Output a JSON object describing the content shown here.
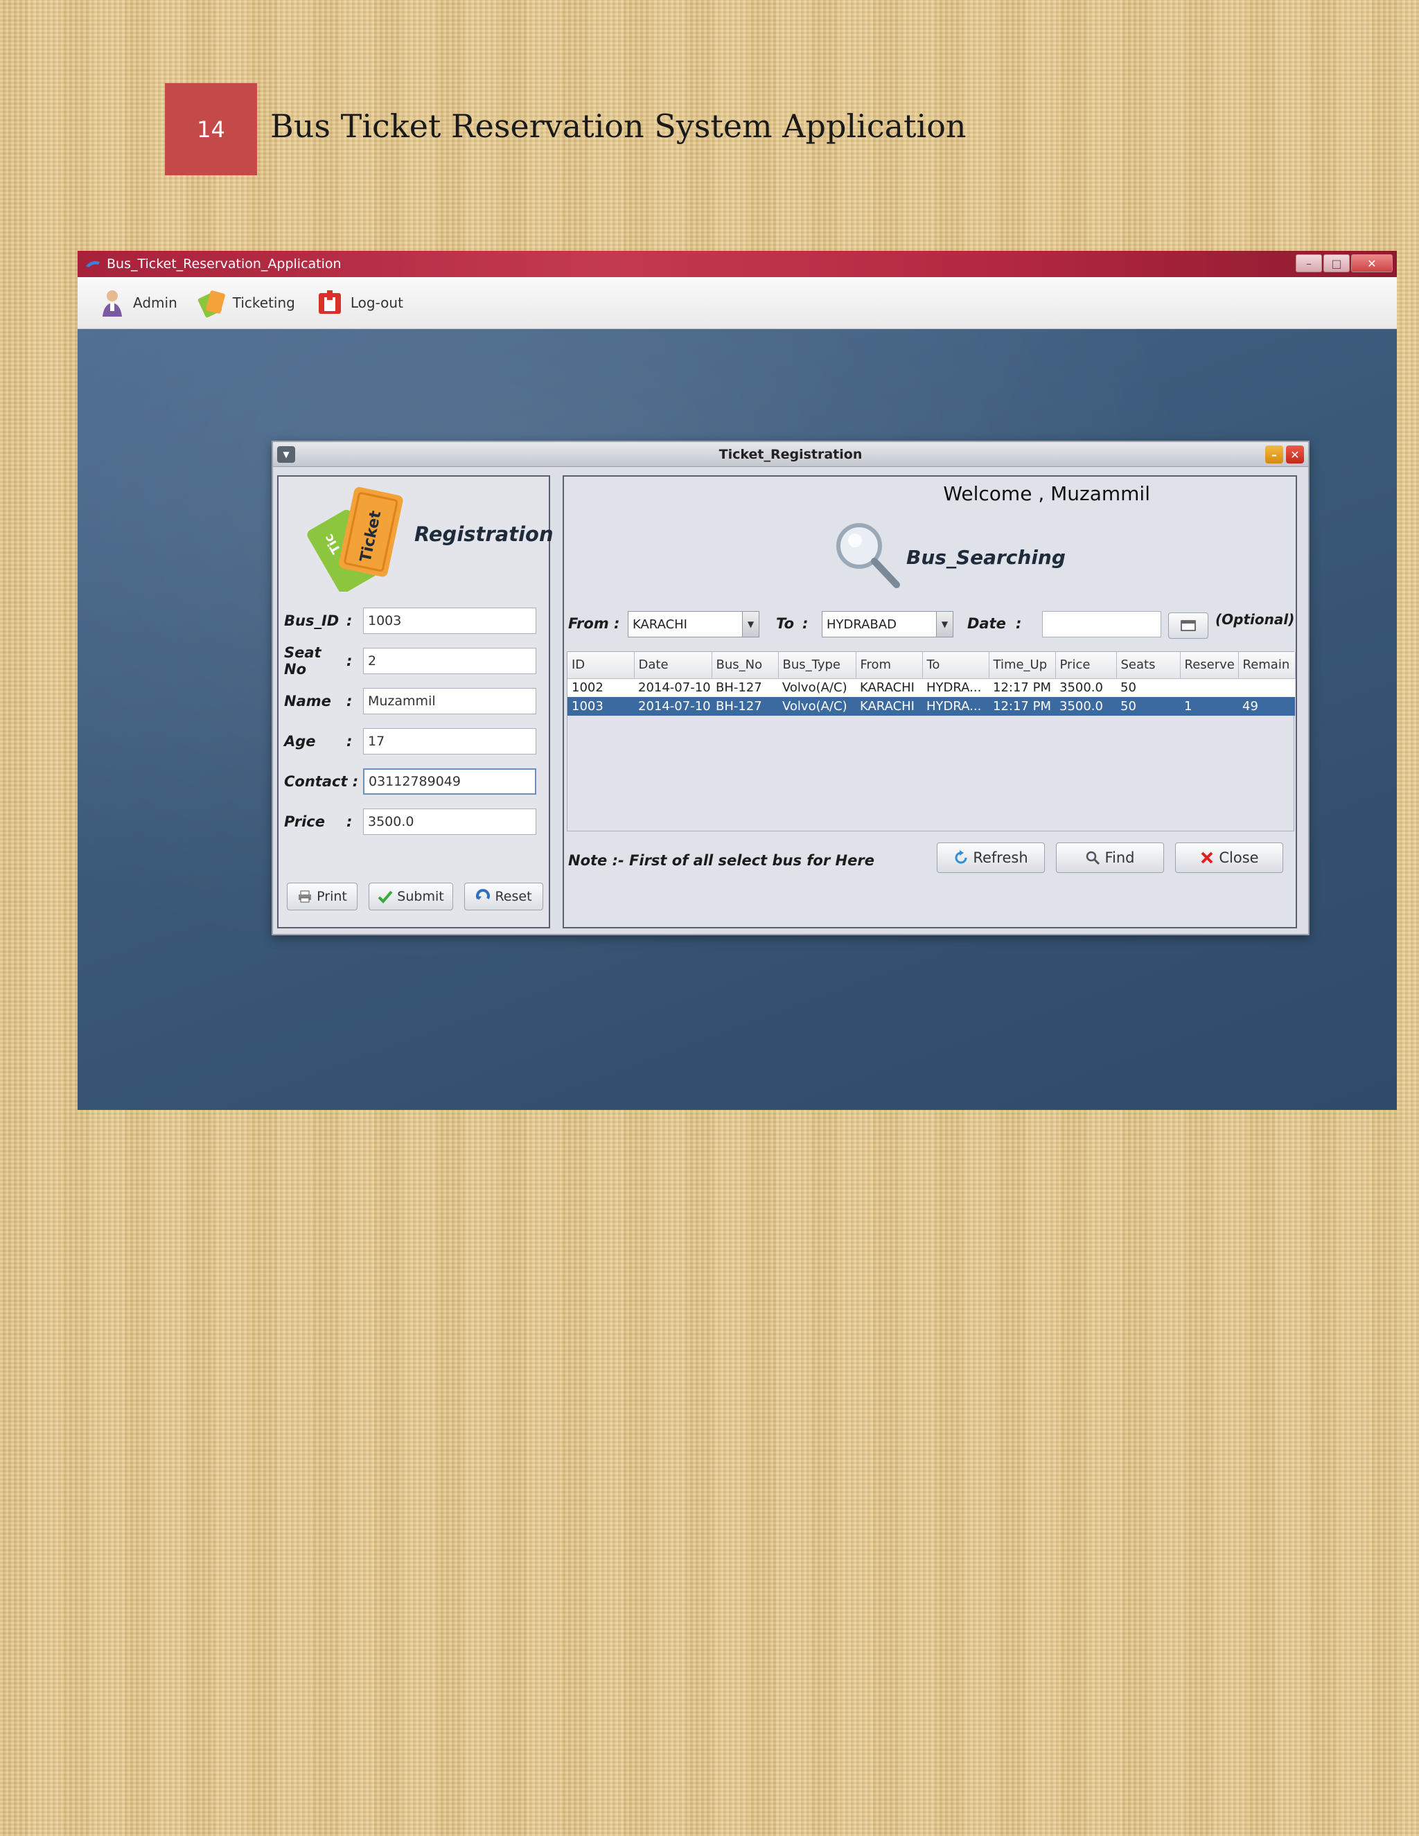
{
  "document": {
    "page_number": "14",
    "title": "Bus Ticket Reservation System Application"
  },
  "app": {
    "window_title": "Bus_Ticket_Reservation_Application",
    "menu": [
      {
        "label": "Admin",
        "icon": "admin-user-icon"
      },
      {
        "label": "Ticketing",
        "icon": "ticket-icon"
      },
      {
        "label": "Log-out",
        "icon": "logout-icon"
      }
    ]
  },
  "frame": {
    "title": "Ticket_Registration",
    "registration": {
      "heading": "Registration",
      "logo_text": [
        "Tic",
        "Ticket"
      ],
      "fields": [
        {
          "label": "Bus_ID",
          "value": "1003"
        },
        {
          "label": "Seat No",
          "value": "2"
        },
        {
          "label": "Name",
          "value": "Muzammil"
        },
        {
          "label": "Age",
          "value": "17"
        },
        {
          "label": "Contact :",
          "value": "03112789049"
        },
        {
          "label": "Price",
          "value": "3500.0"
        }
      ],
      "buttons": {
        "print": "Print",
        "submit": "Submit",
        "reset": "Reset"
      }
    },
    "search": {
      "welcome": "Welcome , Muzammil",
      "heading": "Bus_Searching",
      "from_label": "From :",
      "from_value": "KARACHI",
      "to_label": "To",
      "to_value": "HYDRABAD",
      "date_label": "Date",
      "optional_label": "(Optional)",
      "table": {
        "columns": [
          "ID",
          "Date",
          "Bus_No",
          "Bus_Type",
          "From",
          "To",
          "Time_Up",
          "Price",
          "Seats",
          "Reserve",
          "Remain"
        ],
        "rows": [
          [
            "1002",
            "2014-07-10",
            "BH-127",
            "Volvo(A/C)",
            "KARACHI",
            "HYDRA...",
            "12:17 PM",
            "3500.0",
            "50",
            "",
            ""
          ],
          [
            "1003",
            "2014-07-10",
            "BH-127",
            "Volvo(A/C)",
            "KARACHI",
            "HYDRA...",
            "12:17 PM",
            "3500.0",
            "50",
            "1",
            "49"
          ]
        ]
      },
      "note": "Note :- First of all select bus for Here",
      "buttons": {
        "refresh": "Refresh",
        "find": "Find",
        "close": "Close"
      }
    }
  }
}
